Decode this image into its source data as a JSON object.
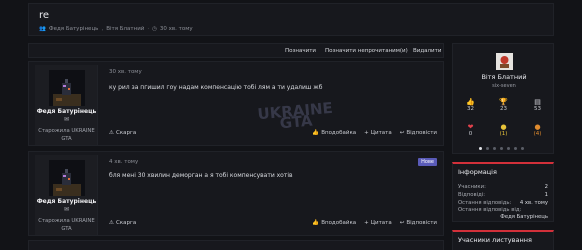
{
  "thread": {
    "title": "re",
    "author": "Федя Батурінець",
    "tagged": "Вітя Блатний",
    "time": "30 хв. тому"
  },
  "filters": {
    "mark_read": "Позначити",
    "mark_unread": "Позначити непрочитаним(и)",
    "delete": "Видалити"
  },
  "posts": [
    {
      "user": "Федя Батурінець",
      "mail_icon": "envelope-icon",
      "rank_line1": "Старожила UKRAINE",
      "rank_line2": "GTA",
      "time": "30 хв. тому",
      "text": "ку рил за пгишил гоу надам компенсацію тобі лям а ти удалиш жб",
      "report": "Скарга",
      "like": "Вподобайка",
      "quote": "Цитата",
      "reply": "Відповісти",
      "badge": ""
    },
    {
      "user": "Федя Батурінець",
      "mail_icon": "envelope-icon",
      "rank_line1": "Старожила UKRAINE",
      "rank_line2": "GTA",
      "time": "4 хв. тому",
      "text": "бля мені 30 хвилин деморган а я тобі компенсувати хотів",
      "report": "Скарга",
      "like": "Вподобайка",
      "quote": "Цитата",
      "reply": "Відповісти",
      "badge": "Нове"
    }
  ],
  "watermark": {
    "line1": "UKRAINE",
    "line2": "GTA"
  },
  "profile": {
    "name": "Вітя Блатний",
    "sub": "six-seven",
    "stats": [
      {
        "icon": "thumbs-up-icon",
        "value": "32"
      },
      {
        "icon": "trophy-icon",
        "value": "23"
      },
      {
        "icon": "message-icon",
        "value": "53"
      },
      {
        "icon": "heart-icon",
        "value": "0"
      },
      {
        "icon": "medal-icon",
        "value": "(1)"
      },
      {
        "icon": "award-icon",
        "value": "(4)"
      }
    ]
  },
  "info": {
    "title": "Інформація",
    "rows": [
      {
        "label": "Учасники:",
        "value": "2"
      },
      {
        "label": "Відповіді:",
        "value": "1"
      },
      {
        "label": "Остання відповідь:",
        "value": "4 хв. тому"
      },
      {
        "label": "Остання відповідь від:",
        "value": ""
      },
      {
        "label": "",
        "value": "Федя Батурінець"
      }
    ]
  },
  "viewers": {
    "title": "Учасники листування"
  },
  "colors": {
    "accent": "#d2303a",
    "badge": "#5a5bb8",
    "background": "#121317",
    "panel": "#17181d"
  }
}
